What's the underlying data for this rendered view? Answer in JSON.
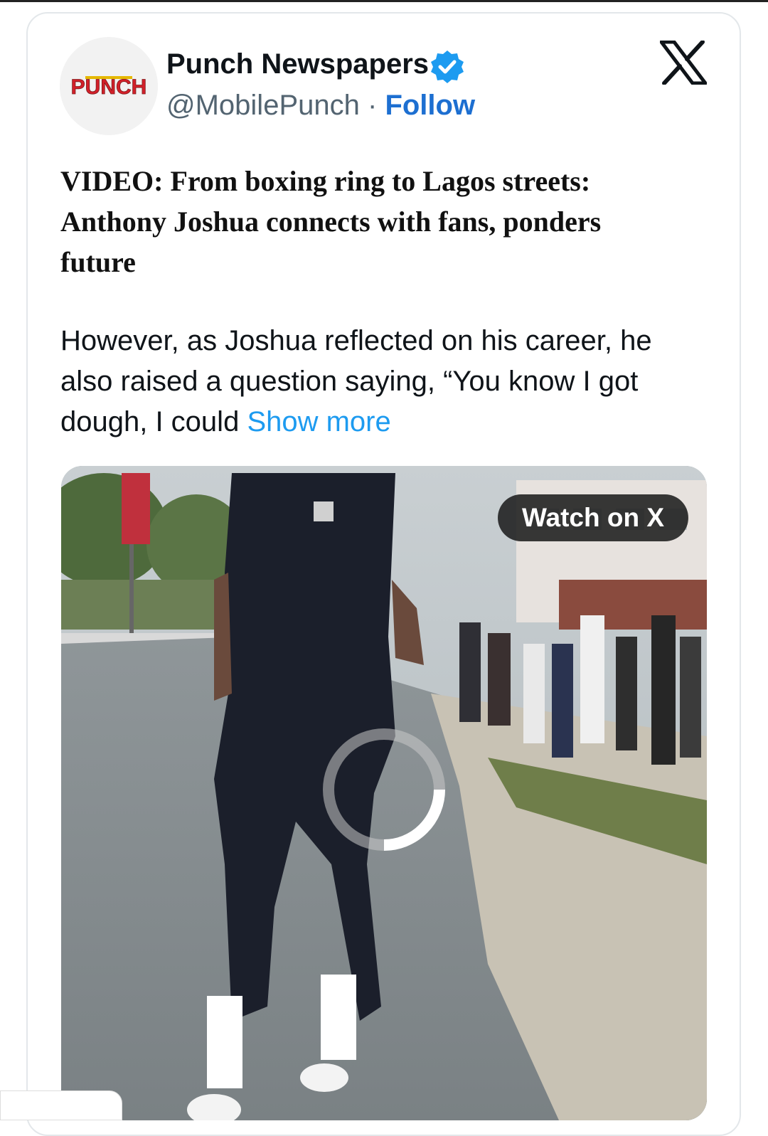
{
  "author": {
    "name": "Punch Newspapers",
    "handle": "@MobilePunch",
    "separator": "·",
    "follow_label": "Follow",
    "logo_text": "PUNCH",
    "verified_color": "#1d9bf0"
  },
  "platform_icon": "x-logo-icon",
  "post": {
    "headline": "VIDEO: From boxing ring to Lagos streets: Anthony Joshua connects with fans, ponders future",
    "body": "However, as Joshua reflected on his career, he also raised a question saying, “You know I got dough, I could",
    "show_more_label": "Show more"
  },
  "media": {
    "watch_label": "Watch on X",
    "loading_icon": "spinner-icon"
  },
  "colors": {
    "link_blue": "#1d6fd1",
    "show_more_blue": "#1d9bf0",
    "punch_red": "#d3202a"
  }
}
